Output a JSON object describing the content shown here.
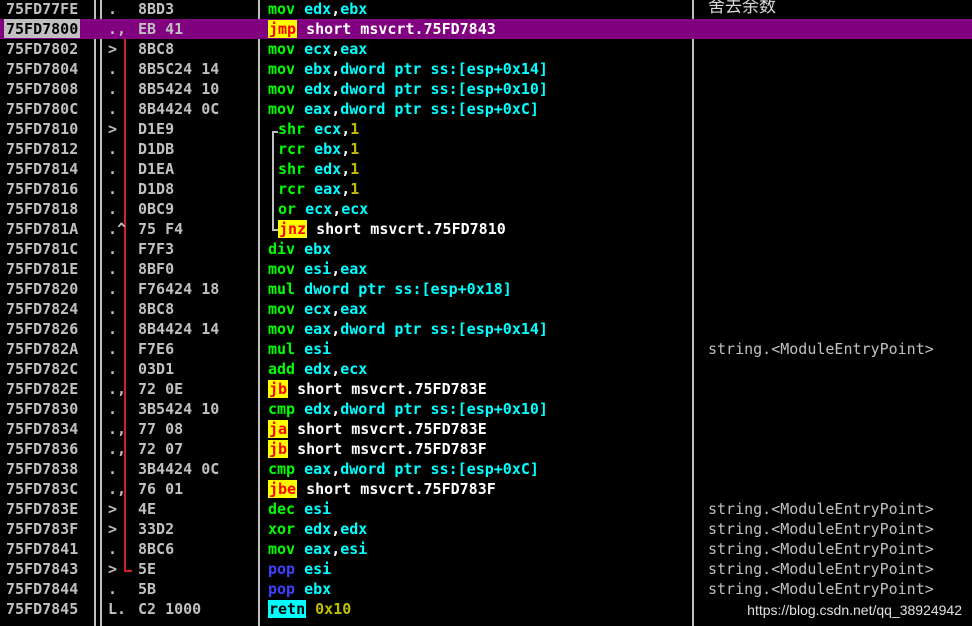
{
  "rows": [
    {
      "addr": "75FD77FE",
      "mark": ".",
      "bytes": "8BD3",
      "ins": [
        [
          "mov ",
          "m"
        ],
        [
          "edx",
          "r"
        ],
        [
          ",",
          "s"
        ],
        [
          "ebx",
          "r"
        ]
      ],
      "comment": "舍去余数",
      "cjk": true
    },
    {
      "addr": "75FD7800",
      "mark": ".,",
      "bytes": "EB 41",
      "ins": [
        [
          "jmp",
          "j"
        ],
        [
          " short msvcrt.75FD7843",
          "s"
        ]
      ],
      "comment": "",
      "sel": true
    },
    {
      "addr": "75FD7802",
      "mark": ">",
      "bytes": "8BC8",
      "ins": [
        [
          "mov ",
          "m"
        ],
        [
          "ecx",
          "r"
        ],
        [
          ",",
          "s"
        ],
        [
          "eax",
          "r"
        ]
      ],
      "comment": ""
    },
    {
      "addr": "75FD7804",
      "mark": ".",
      "bytes": "8B5C24 14",
      "ins": [
        [
          "mov ",
          "m"
        ],
        [
          "ebx",
          "r"
        ],
        [
          ",",
          "s"
        ],
        [
          "dword ptr ss:[esp+0x14]",
          "r"
        ]
      ],
      "comment": ""
    },
    {
      "addr": "75FD7808",
      "mark": ".",
      "bytes": "8B5424 10",
      "ins": [
        [
          "mov ",
          "m"
        ],
        [
          "edx",
          "r"
        ],
        [
          ",",
          "s"
        ],
        [
          "dword ptr ss:[esp+0x10]",
          "r"
        ]
      ],
      "comment": ""
    },
    {
      "addr": "75FD780C",
      "mark": ".",
      "bytes": "8B4424 0C",
      "ins": [
        [
          "mov ",
          "m"
        ],
        [
          "eax",
          "r"
        ],
        [
          ",",
          "s"
        ],
        [
          "dword ptr ss:[esp+0xC]",
          "r"
        ]
      ],
      "comment": ""
    },
    {
      "addr": "75FD7810",
      "mark": ">",
      "bytes": "D1E9",
      "ins": [
        [
          "shr ",
          "m"
        ],
        [
          "ecx",
          "r"
        ],
        [
          ",",
          "s"
        ],
        [
          "1",
          "i"
        ]
      ],
      "comment": "",
      "loop": true
    },
    {
      "addr": "75FD7812",
      "mark": ".",
      "bytes": "D1DB",
      "ins": [
        [
          "rcr ",
          "m"
        ],
        [
          "ebx",
          "r"
        ],
        [
          ",",
          "s"
        ],
        [
          "1",
          "i"
        ]
      ],
      "comment": "",
      "loop": true
    },
    {
      "addr": "75FD7814",
      "mark": ".",
      "bytes": "D1EA",
      "ins": [
        [
          "shr ",
          "m"
        ],
        [
          "edx",
          "r"
        ],
        [
          ",",
          "s"
        ],
        [
          "1",
          "i"
        ]
      ],
      "comment": "",
      "loop": true
    },
    {
      "addr": "75FD7816",
      "mark": ".",
      "bytes": "D1D8",
      "ins": [
        [
          "rcr ",
          "m"
        ],
        [
          "eax",
          "r"
        ],
        [
          ",",
          "s"
        ],
        [
          "1",
          "i"
        ]
      ],
      "comment": "",
      "loop": true
    },
    {
      "addr": "75FD7818",
      "mark": ".",
      "bytes": "0BC9",
      "ins": [
        [
          "or ",
          "m"
        ],
        [
          "ecx",
          "r"
        ],
        [
          ",",
          "s"
        ],
        [
          "ecx",
          "r"
        ]
      ],
      "comment": "",
      "loop": true
    },
    {
      "addr": "75FD781A",
      "mark": ".^",
      "bytes": "75 F4",
      "ins": [
        [
          "jnz",
          "j"
        ],
        [
          " short msvcrt.75FD7810",
          "s"
        ]
      ],
      "comment": "",
      "loop": true
    },
    {
      "addr": "75FD781C",
      "mark": ".",
      "bytes": "F7F3",
      "ins": [
        [
          "div ",
          "m"
        ],
        [
          "ebx",
          "r"
        ]
      ],
      "comment": ""
    },
    {
      "addr": "75FD781E",
      "mark": ".",
      "bytes": "8BF0",
      "ins": [
        [
          "mov ",
          "m"
        ],
        [
          "esi",
          "r"
        ],
        [
          ",",
          "s"
        ],
        [
          "eax",
          "r"
        ]
      ],
      "comment": ""
    },
    {
      "addr": "75FD7820",
      "mark": ".",
      "bytes": "F76424 18",
      "ins": [
        [
          "mul ",
          "m"
        ],
        [
          "dword ptr ss:[esp+0x18]",
          "r"
        ]
      ],
      "comment": ""
    },
    {
      "addr": "75FD7824",
      "mark": ".",
      "bytes": "8BC8",
      "ins": [
        [
          "mov ",
          "m"
        ],
        [
          "ecx",
          "r"
        ],
        [
          ",",
          "s"
        ],
        [
          "eax",
          "r"
        ]
      ],
      "comment": ""
    },
    {
      "addr": "75FD7826",
      "mark": ".",
      "bytes": "8B4424 14",
      "ins": [
        [
          "mov ",
          "m"
        ],
        [
          "eax",
          "r"
        ],
        [
          ",",
          "s"
        ],
        [
          "dword ptr ss:[esp+0x14]",
          "r"
        ]
      ],
      "comment": ""
    },
    {
      "addr": "75FD782A",
      "mark": ".",
      "bytes": "F7E6",
      "ins": [
        [
          "mul ",
          "m"
        ],
        [
          "esi",
          "r"
        ]
      ],
      "comment": "string.<ModuleEntryPoint>"
    },
    {
      "addr": "75FD782C",
      "mark": ".",
      "bytes": "03D1",
      "ins": [
        [
          "add ",
          "m"
        ],
        [
          "edx",
          "r"
        ],
        [
          ",",
          "s"
        ],
        [
          "ecx",
          "r"
        ]
      ],
      "comment": ""
    },
    {
      "addr": "75FD782E",
      "mark": ".,",
      "bytes": "72 0E",
      "ins": [
        [
          "jb",
          "j"
        ],
        [
          " short msvcrt.75FD783E",
          "s"
        ]
      ],
      "comment": ""
    },
    {
      "addr": "75FD7830",
      "mark": ".",
      "bytes": "3B5424 10",
      "ins": [
        [
          "cmp ",
          "m"
        ],
        [
          "edx",
          "r"
        ],
        [
          ",",
          "s"
        ],
        [
          "dword ptr ss:[esp+0x10]",
          "r"
        ]
      ],
      "comment": ""
    },
    {
      "addr": "75FD7834",
      "mark": ".,",
      "bytes": "77 08",
      "ins": [
        [
          "ja",
          "j"
        ],
        [
          " short msvcrt.75FD783E",
          "s"
        ]
      ],
      "comment": ""
    },
    {
      "addr": "75FD7836",
      "mark": ".,",
      "bytes": "72 07",
      "ins": [
        [
          "jb",
          "j"
        ],
        [
          " short msvcrt.75FD783F",
          "s"
        ]
      ],
      "comment": ""
    },
    {
      "addr": "75FD7838",
      "mark": ".",
      "bytes": "3B4424 0C",
      "ins": [
        [
          "cmp ",
          "m"
        ],
        [
          "eax",
          "r"
        ],
        [
          ",",
          "s"
        ],
        [
          "dword ptr ss:[esp+0xC]",
          "r"
        ]
      ],
      "comment": ""
    },
    {
      "addr": "75FD783C",
      "mark": ".,",
      "bytes": "76 01",
      "ins": [
        [
          "jbe",
          "j"
        ],
        [
          " short msvcrt.75FD783F",
          "s"
        ]
      ],
      "comment": ""
    },
    {
      "addr": "75FD783E",
      "mark": ">",
      "bytes": "4E",
      "ins": [
        [
          "dec ",
          "m"
        ],
        [
          "esi",
          "r"
        ]
      ],
      "comment": "string.<ModuleEntryPoint>"
    },
    {
      "addr": "75FD783F",
      "mark": ">",
      "bytes": "33D2",
      "ins": [
        [
          "xor ",
          "m"
        ],
        [
          "edx",
          "r"
        ],
        [
          ",",
          "s"
        ],
        [
          "edx",
          "r"
        ]
      ],
      "comment": "string.<ModuleEntryPoint>"
    },
    {
      "addr": "75FD7841",
      "mark": ".",
      "bytes": "8BC6",
      "ins": [
        [
          "mov ",
          "m"
        ],
        [
          "eax",
          "r"
        ],
        [
          ",",
          "s"
        ],
        [
          "esi",
          "r"
        ]
      ],
      "comment": "string.<ModuleEntryPoint>"
    },
    {
      "addr": "75FD7843",
      "mark": ">",
      "bytes": "5E",
      "ins": [
        [
          "pop ",
          "p"
        ],
        [
          "esi",
          "r"
        ]
      ],
      "comment": "string.<ModuleEntryPoint>"
    },
    {
      "addr": "75FD7844",
      "mark": ".",
      "bytes": "5B",
      "ins": [
        [
          "pop ",
          "p"
        ],
        [
          "ebx",
          "r"
        ]
      ],
      "comment": "string.<ModuleEntryPoint>"
    },
    {
      "addr": "75FD7845",
      "mark": "L.",
      "bytes": "C2 1000",
      "ins": [
        [
          "retn",
          "t"
        ],
        [
          " 0x10",
          "i"
        ]
      ],
      "comment": ""
    }
  ],
  "watermark": "https://blog.csdn.net/qq_38924942"
}
